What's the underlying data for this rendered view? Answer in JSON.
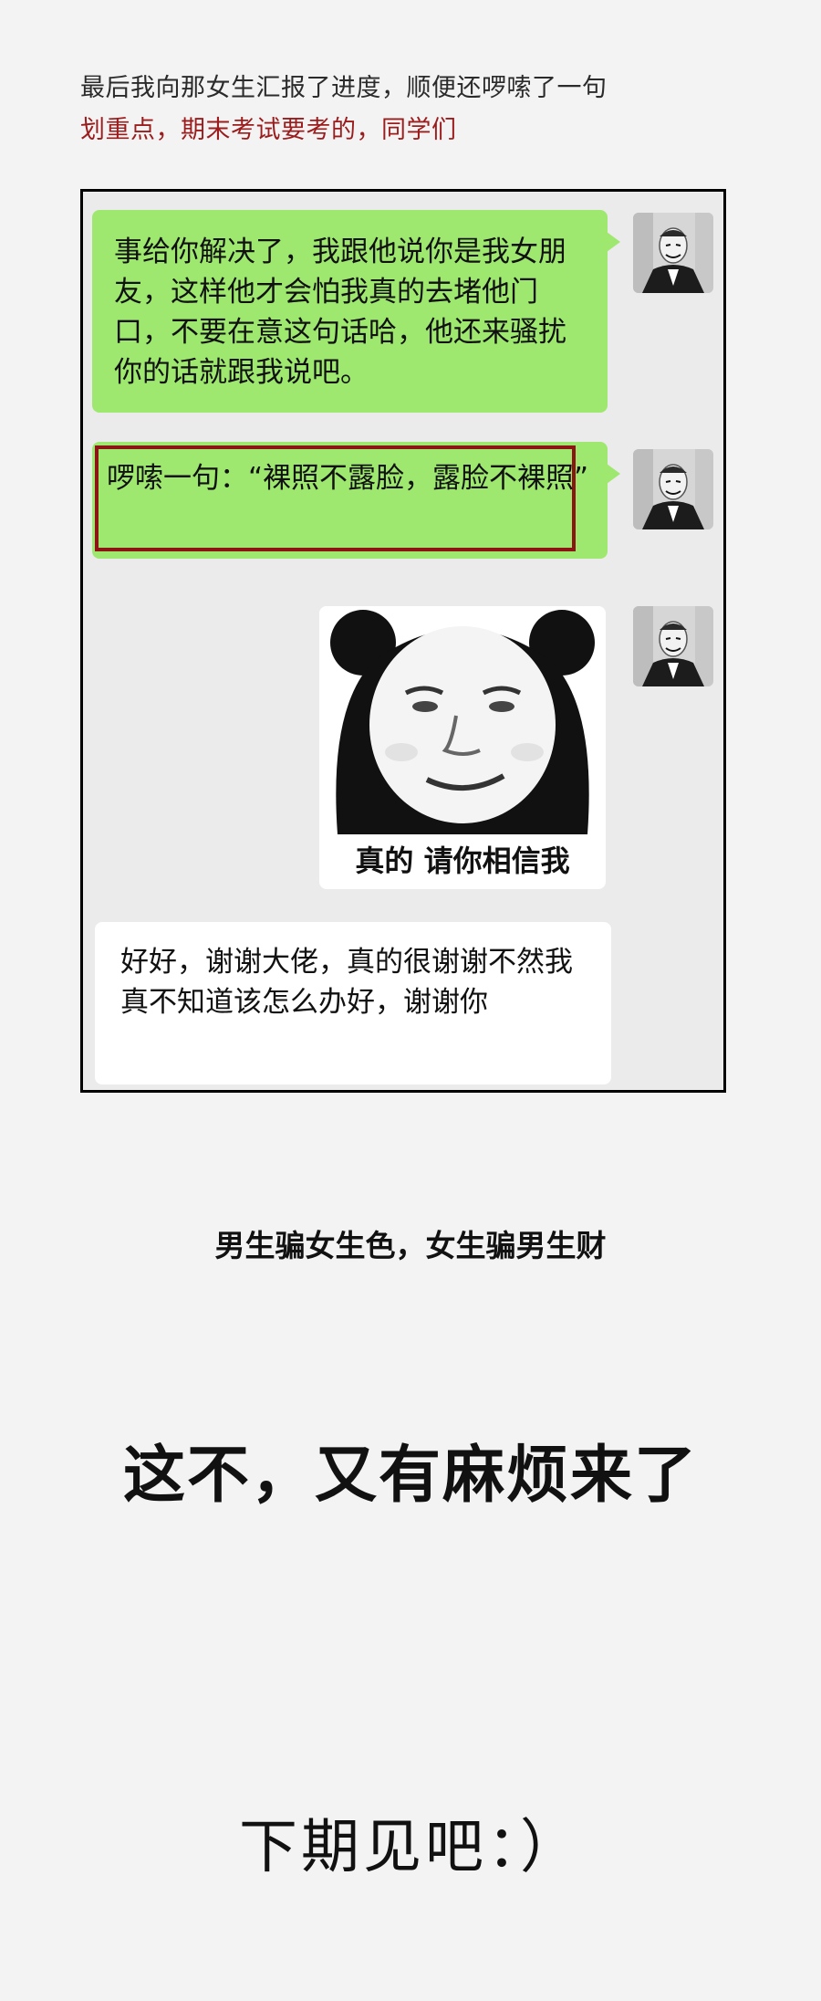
{
  "intro": {
    "line1": "最后我向那女生汇报了进度，顺便还啰嗦了一句",
    "line2": "划重点，期末考试要考的，同学们",
    "line2_color": "#9b1c1c"
  },
  "chat": {
    "messages": [
      {
        "side": "right",
        "type": "text",
        "text": "事给你解决了，我跟他说你是我女朋友，这样他才会怕我真的去堵他门口，不要在意这句话哈，他还来骚扰你的话就跟我说吧。"
      },
      {
        "side": "right",
        "type": "text",
        "text": "啰嗦一句：“裸照不露脸，露脸不裸照”",
        "highlight_color": "#8d1414"
      },
      {
        "side": "right",
        "type": "sticker",
        "icon": "panda-face-meme",
        "caption": "真的 请你相信我"
      },
      {
        "side": "left",
        "type": "text",
        "text": "好好，谢谢大佬，真的很谢谢不然我真不知道该怎么办好，谢谢你"
      }
    ],
    "bubble_color": "#9fe870",
    "avatar_icon": "guy-fawkes-mask-avatar"
  },
  "footer": {
    "tagline": "男生骗女生色，女生骗男生财",
    "headline": "这不，又有麻烦来了",
    "signoff": "下期见吧：）"
  }
}
